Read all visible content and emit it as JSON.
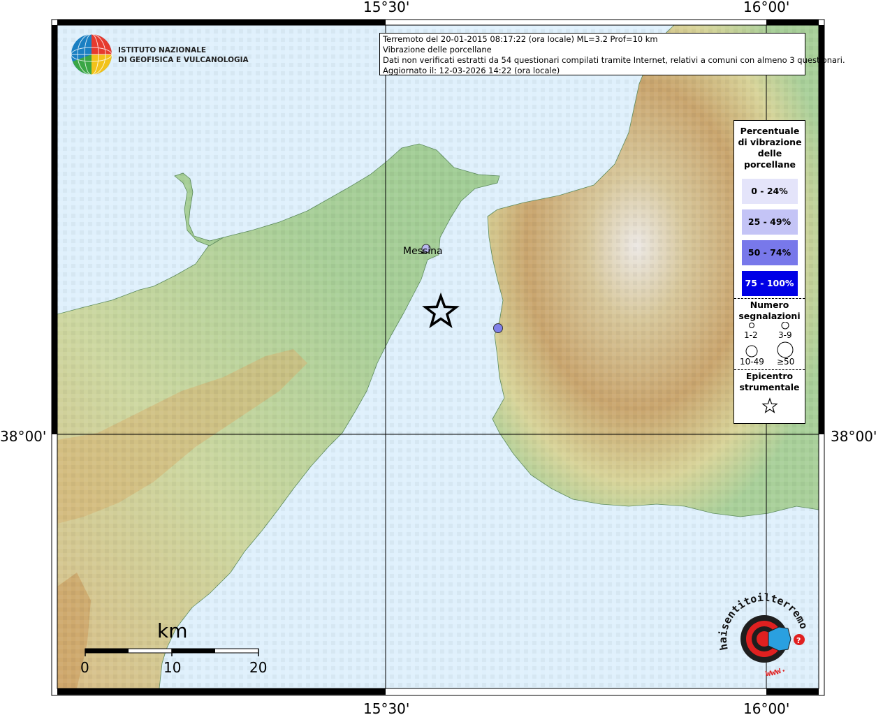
{
  "axes": {
    "lon_ticks": [
      "15°30'",
      "16°00'"
    ],
    "lat_ticks": [
      "38°00'"
    ]
  },
  "header": {
    "line1": "Terremoto del 20-01-2015 08:17:22 (ora locale) ML=3.2 Prof=10 km",
    "line2": "Vibrazione delle porcellane",
    "line3": "Dati non verificati estratti da 54 questionari compilati tramite Internet, relativi a comuni con almeno 3 questionari.",
    "line4": "Aggiornato il: 12-03-2026 14:22 (ora locale)"
  },
  "ingv_logo": {
    "line1": "ISTITUTO NAZIONALE",
    "line2": "DI GEOFISICA E VULCANOLOGIA"
  },
  "places": [
    {
      "name": "Messina",
      "color": "#b8b8ee"
    },
    {
      "name": "",
      "color": "#8080e8"
    }
  ],
  "legend": {
    "title": "Percentuale di vibrazione delle porcellane",
    "classes": [
      {
        "label": "0 - 24%",
        "color": "#e4e4fa",
        "text_color": "#000000"
      },
      {
        "label": "25 - 49%",
        "color": "#c4c4f6",
        "text_color": "#000000"
      },
      {
        "label": "50 - 74%",
        "color": "#7878ea",
        "text_color": "#000000"
      },
      {
        "label": "75 - 100%",
        "color": "#0000e6",
        "text_color": "#ffffff"
      }
    ],
    "count_title": "Numero segnalazioni",
    "counts": [
      "1-2",
      "3-9",
      "10-49",
      "≥50"
    ],
    "epicenter_title": "Epicentro strumentale",
    "epicenter_icon": "star-icon"
  },
  "scale_bar": {
    "unit": "km",
    "labels": [
      "0",
      "10",
      "20"
    ]
  },
  "watermark": {
    "text": "haisentitoilterremoto.it",
    "www": "www.",
    "icon": "speaker-icon"
  },
  "colors": {
    "sea": "#dff0fc",
    "lowland": "#a7cf97",
    "hill": "#e6dfa9",
    "mountain": "#c9a46c",
    "peak": "#ebe6e0",
    "frame": "#000000"
  }
}
